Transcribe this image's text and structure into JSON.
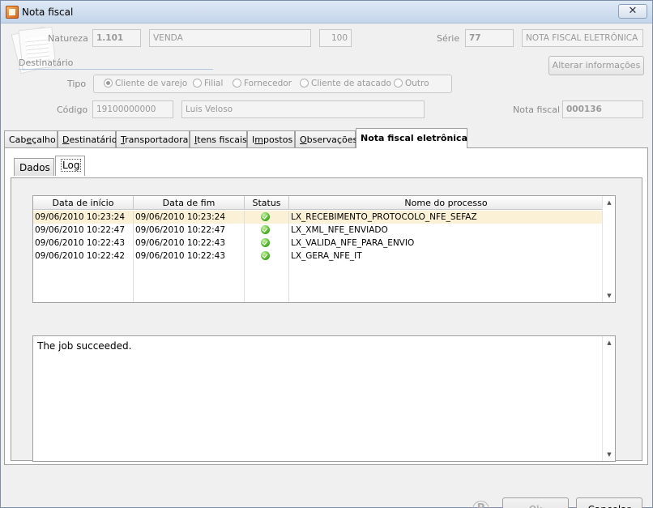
{
  "window": {
    "title": "Nota fiscal",
    "close_glyph": "✕"
  },
  "header": {
    "natureza_label": "Natureza",
    "natureza_code": "1.101",
    "natureza_desc": "VENDA",
    "natureza_num": "100",
    "serie_label": "Série",
    "serie_value": "77",
    "serie_desc": "NOTA FISCAL ELETRÔNICA",
    "destinatario_label": "Destinatário",
    "alterar_button": "Alterar informações",
    "tipo_label": "Tipo",
    "tipo_options": [
      "Cliente de varejo",
      "Filial",
      "Fornecedor",
      "Cliente de atacado",
      "Outro"
    ],
    "codigo_label": "Código",
    "codigo_value": "19100000000",
    "cliente_nome": "Luis Veloso",
    "nota_fiscal_label": "Nota fiscal",
    "nota_fiscal_value": "000136"
  },
  "tabs": [
    {
      "pre": "Cab",
      "u": "e",
      "post": "çalho"
    },
    {
      "pre": "",
      "u": "D",
      "post": "estinatário"
    },
    {
      "pre": "",
      "u": "T",
      "post": "ransportadora"
    },
    {
      "pre": "",
      "u": "I",
      "post": "tens fiscais"
    },
    {
      "pre": "I",
      "u": "m",
      "post": "postos"
    },
    {
      "pre": "",
      "u": "O",
      "post": "bservações"
    },
    {
      "pre": "Nota fiscal eletrônica",
      "u": "",
      "post": ""
    }
  ],
  "subtabs": [
    "Dados",
    "Log"
  ],
  "grid": {
    "columns": [
      "Data de início",
      "Data de fim",
      "Status",
      "Nome do processo"
    ],
    "rows": [
      {
        "inicio": "09/06/2010 10:23:24",
        "fim": "09/06/2010 10:23:24",
        "status": "ok-icon",
        "processo": "LX_RECEBIMENTO_PROTOCOLO_NFE_SEFAZ"
      },
      {
        "inicio": "09/06/2010 10:22:47",
        "fim": "09/06/2010 10:22:47",
        "status": "ok-icon",
        "processo": "LX_XML_NFE_ENVIADO"
      },
      {
        "inicio": "09/06/2010 10:22:43",
        "fim": "09/06/2010 10:22:43",
        "status": "ok-icon",
        "processo": "LX_VALIDA_NFE_PARA_ENVIO"
      },
      {
        "inicio": "09/06/2010 10:22:42",
        "fim": "09/06/2010 10:22:43",
        "status": "ok-icon",
        "processo": "LX_GERA_NFE_IT"
      }
    ]
  },
  "log": {
    "message": "The job succeeded."
  },
  "footer": {
    "pic_glyph": "P",
    "ok_u": "O",
    "ok_post": "k",
    "cancel_u": "C",
    "cancel_post": "ancelar"
  },
  "scroll": {
    "up": "▲",
    "down": "▼"
  }
}
